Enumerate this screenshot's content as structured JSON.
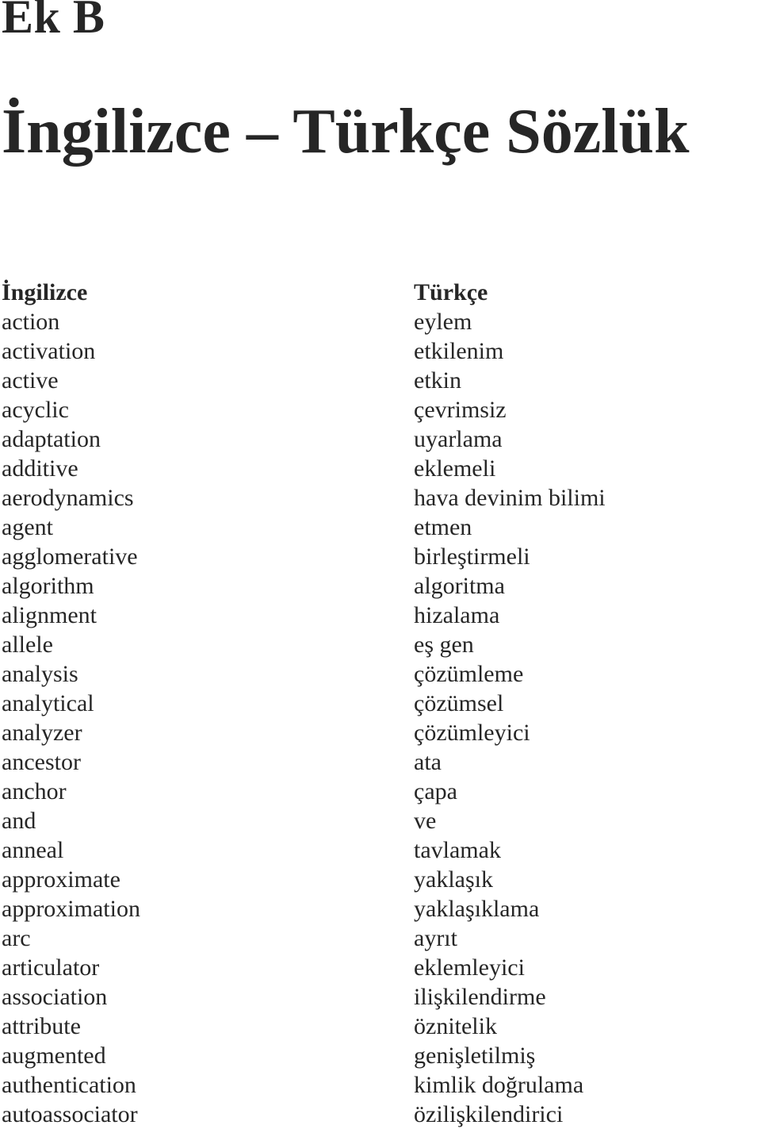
{
  "appendix": {
    "label": "Ek B"
  },
  "title": {
    "text": "İngilizce – Türkçe Sözlük"
  },
  "glossary": {
    "header": {
      "english": "İngilizce",
      "turkish": "Türkçe"
    },
    "entries": [
      {
        "english": "action",
        "turkish": "eylem"
      },
      {
        "english": "activation",
        "turkish": "etkilenim"
      },
      {
        "english": "active",
        "turkish": "etkin"
      },
      {
        "english": "acyclic",
        "turkish": "çevrimsiz"
      },
      {
        "english": "adaptation",
        "turkish": "uyarlama"
      },
      {
        "english": "additive",
        "turkish": "eklemeli"
      },
      {
        "english": "aerodynamics",
        "turkish": "hava devinim bilimi"
      },
      {
        "english": "agent",
        "turkish": "etmen"
      },
      {
        "english": "agglomerative",
        "turkish": "birleştirmeli"
      },
      {
        "english": "algorithm",
        "turkish": "algoritma"
      },
      {
        "english": "alignment",
        "turkish": "hizalama"
      },
      {
        "english": "allele",
        "turkish": "eş gen"
      },
      {
        "english": "analysis",
        "turkish": "çözümleme"
      },
      {
        "english": "analytical",
        "turkish": "çözümsel"
      },
      {
        "english": "analyzer",
        "turkish": "çözümleyici"
      },
      {
        "english": "ancestor",
        "turkish": "ata"
      },
      {
        "english": "anchor",
        "turkish": "çapa"
      },
      {
        "english": "and",
        "turkish": "ve"
      },
      {
        "english": "anneal",
        "turkish": "tavlamak"
      },
      {
        "english": "approximate",
        "turkish": "yaklaşık"
      },
      {
        "english": "approximation",
        "turkish": "yaklaşıklama"
      },
      {
        "english": "arc",
        "turkish": "ayrıt"
      },
      {
        "english": "articulator",
        "turkish": "eklemleyici"
      },
      {
        "english": "association",
        "turkish": "ilişkilendirme"
      },
      {
        "english": "attribute",
        "turkish": "öznitelik"
      },
      {
        "english": "augmented",
        "turkish": "genişletilmiş"
      },
      {
        "english": "authentication",
        "turkish": "kimlik doğrulama"
      },
      {
        "english": "autoassociator",
        "turkish": "özilişkilendirici"
      }
    ]
  }
}
